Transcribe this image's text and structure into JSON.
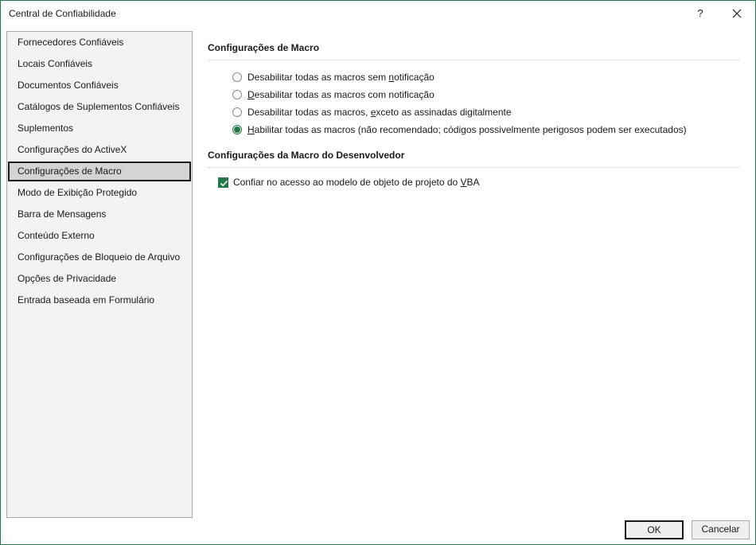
{
  "window": {
    "title": "Central de Confiabilidade",
    "help_label": "?",
    "accent_color": "#1f7a45"
  },
  "sidebar": {
    "items": [
      {
        "label": "Fornecedores Confiáveis",
        "selected": false
      },
      {
        "label": "Locais Confiáveis",
        "selected": false
      },
      {
        "label": "Documentos Confiáveis",
        "selected": false
      },
      {
        "label": "Catálogos de Suplementos Confiáveis",
        "selected": false
      },
      {
        "label": "Suplementos",
        "selected": false
      },
      {
        "label": "Configurações do ActiveX",
        "selected": false
      },
      {
        "label": "Configurações de Macro",
        "selected": true
      },
      {
        "label": "Modo de Exibição Protegido",
        "selected": false
      },
      {
        "label": "Barra de Mensagens",
        "selected": false
      },
      {
        "label": "Conteúdo Externo",
        "selected": false
      },
      {
        "label": "Configurações de Bloqueio de Arquivo",
        "selected": false
      },
      {
        "label": "Opções de Privacidade",
        "selected": false
      },
      {
        "label": "Entrada baseada em Formulário",
        "selected": false
      }
    ]
  },
  "macro_settings": {
    "title": "Configurações de Macro",
    "options": [
      {
        "pre": "Desabilitar todas as macros sem ",
        "accel": "n",
        "post": "otificação",
        "checked": false
      },
      {
        "pre": "",
        "accel": "D",
        "post": "esabilitar todas as macros com notificação",
        "checked": false
      },
      {
        "pre": "Desabilitar todas as macros, ",
        "accel": "e",
        "post": "xceto as assinadas digitalmente",
        "checked": false
      },
      {
        "pre": "",
        "accel": "H",
        "post": "abilitar todas as macros (não recomendado; códigos possivelmente perigosos podem ser executados)",
        "checked": true
      }
    ]
  },
  "developer_settings": {
    "title": "Configurações da Macro do Desenvolvedor",
    "vba_trust": {
      "pre": "Confiar no acesso ao modelo de objeto de projeto do ",
      "accel": "V",
      "post": "BA",
      "checked": true
    }
  },
  "buttons": {
    "ok_label": "OK",
    "cancel_label": "Cancelar"
  }
}
